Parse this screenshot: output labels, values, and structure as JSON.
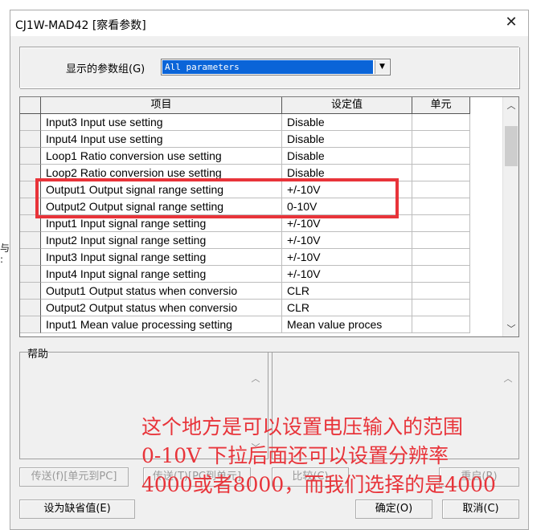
{
  "window": {
    "title": "CJ1W-MAD42 [察看参数]",
    "close_glyph": "✕"
  },
  "left_fragment": "与\n:",
  "param_group": {
    "label": "显示的参数组(G)",
    "selected": "All parameters"
  },
  "table": {
    "columns": [
      "项目",
      "设定值",
      "单元"
    ],
    "rows": [
      {
        "item": "Input3 Input use setting",
        "value": "Disable",
        "unit": ""
      },
      {
        "item": "Input4 Input use setting",
        "value": "Disable",
        "unit": ""
      },
      {
        "item": "Loop1 Ratio conversion use setting",
        "value": "Disable",
        "unit": ""
      },
      {
        "item": "Loop2 Ratio conversion use setting",
        "value": "Disable",
        "unit": ""
      },
      {
        "item": "Output1 Output signal  range setting",
        "value": "+/-10V",
        "unit": ""
      },
      {
        "item": "Output2 Output signal  range setting",
        "value": "0-10V",
        "unit": ""
      },
      {
        "item": "Input1 Input signal range setting",
        "value": "+/-10V",
        "unit": ""
      },
      {
        "item": "Input2 Input signal range setting",
        "value": "+/-10V",
        "unit": ""
      },
      {
        "item": "Input3 Input signal range setting",
        "value": "+/-10V",
        "unit": ""
      },
      {
        "item": "Input4 Input signal range setting",
        "value": "+/-10V",
        "unit": ""
      },
      {
        "item": "Output1 Output status when conversio",
        "value": "CLR",
        "unit": ""
      },
      {
        "item": "Output2 Output status when conversio",
        "value": "CLR",
        "unit": ""
      },
      {
        "item": "Input1 Mean value processing setting",
        "value": "Mean value proces",
        "unit": ""
      }
    ]
  },
  "help": {
    "label": "帮助"
  },
  "buttons": {
    "transfer_unit_to_pc": "传送(f)[单元到PC]",
    "transfer_pc_to_unit": "传送(T)[PC到单元]",
    "compare": "比较(C)",
    "restart": "重启(R)",
    "set_default": "设为缺省值(E)",
    "ok": "确定(O)",
    "cancel": "取消(C)"
  },
  "annotation": {
    "line1": "这个地方是可以设置电压输入的范围",
    "line2": "0-10V  下拉后面还可以设置分辨率",
    "line3": "4000或者8000，而我们选择的是4000",
    "color": "#e8343a"
  },
  "colors": {
    "highlight_border": "#e8343a",
    "selection_blue": "#0a64d8"
  },
  "icons": {
    "close": "close-icon",
    "dropdown": "chevron-down-icon",
    "scroll_up": "chevron-up-icon",
    "scroll_down": "chevron-down-icon"
  }
}
